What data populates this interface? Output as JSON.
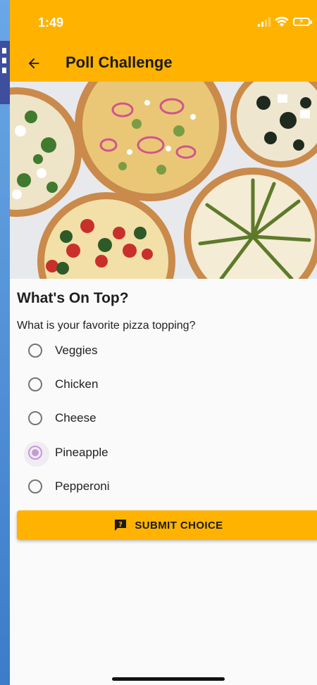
{
  "status_bar": {
    "time": "1:49"
  },
  "app_bar": {
    "title": "Poll Challenge"
  },
  "poll": {
    "title": "What's On Top?",
    "question": "What is your favorite pizza topping?",
    "options": [
      {
        "label": "Veggies",
        "selected": false
      },
      {
        "label": "Chicken",
        "selected": false
      },
      {
        "label": "Cheese",
        "selected": false
      },
      {
        "label": "Pineapple",
        "selected": true
      },
      {
        "label": "Pepperoni",
        "selected": false
      }
    ],
    "submit_label": "SUBMIT CHOICE"
  },
  "colors": {
    "accent": "#ffb300",
    "radio_selected": "#c39bd6",
    "background": "#fafafa"
  },
  "icons": {
    "back": "arrow-left-icon",
    "submit": "feedback-question-icon",
    "wifi": "wifi-icon",
    "battery": "battery-charging-icon",
    "signal": "signal-icon"
  }
}
